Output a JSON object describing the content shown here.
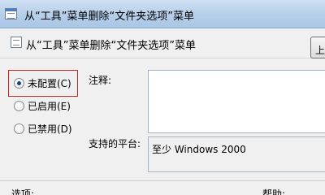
{
  "window": {
    "title": "从“工具”菜单删除“文件夹选项”菜单"
  },
  "policy": {
    "title": "从“工具”菜单删除“文件夹选项”菜单"
  },
  "options": [
    {
      "label": "未配置(C)",
      "checked": true
    },
    {
      "label": "已启用(E)",
      "checked": false
    },
    {
      "label": "已禁用(D)",
      "checked": false
    }
  ],
  "comment": {
    "label": "注释:",
    "value": ""
  },
  "supported": {
    "label": "支持的平台:",
    "value": "至少 Windows 2000"
  },
  "bottom": {
    "options_label": "选项:",
    "help_label": "帮助:"
  },
  "top_button": {
    "label": "上"
  }
}
